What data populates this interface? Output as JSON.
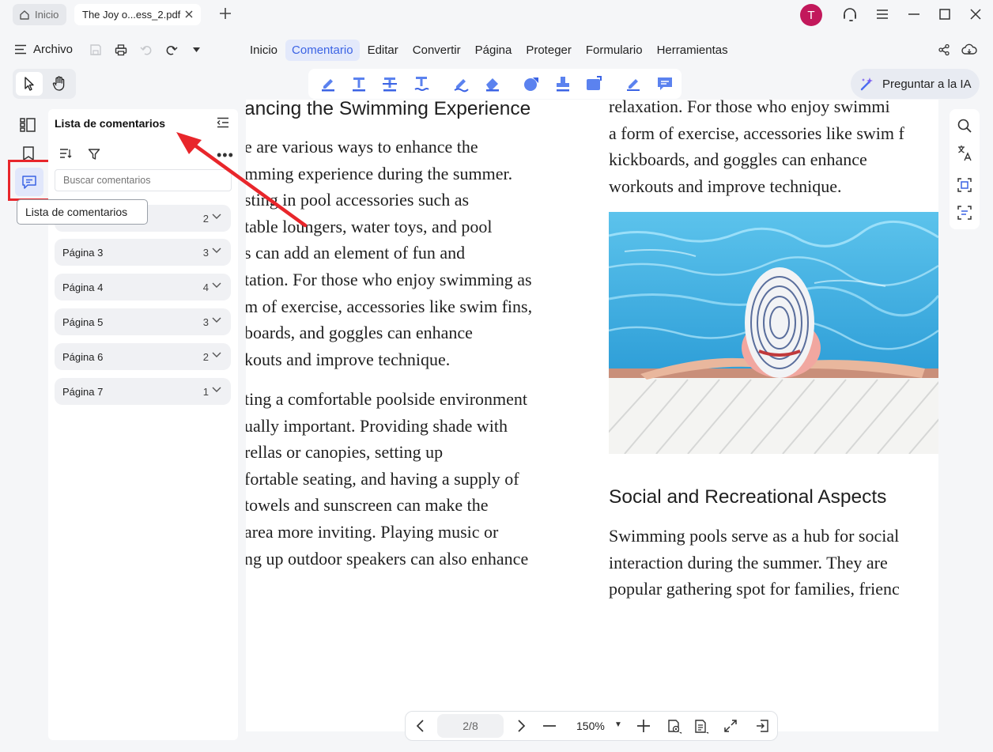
{
  "tabs": {
    "home_label": "Inicio",
    "doc_label": "The Joy o...ess_2.pdf"
  },
  "user": {
    "avatar_initial": "T",
    "avatar_color": "#c2185b"
  },
  "menubar": {
    "file_label": "Archivo",
    "items": [
      "Inicio",
      "Comentario",
      "Editar",
      "Convertir",
      "Página",
      "Proteger",
      "Formulario",
      "Herramientas"
    ],
    "active_index": 1
  },
  "ai": {
    "label": "Preguntar a la IA"
  },
  "tooltip": {
    "text": "Lista de comentarios"
  },
  "comments_panel": {
    "title": "Lista de comentarios",
    "search_placeholder": "Buscar comentarios",
    "first_row_count": "2",
    "pages": [
      {
        "label": "Página 3",
        "count": "3"
      },
      {
        "label": "Página 4",
        "count": "4"
      },
      {
        "label": "Página 5",
        "count": "3"
      },
      {
        "label": "Página 6",
        "count": "2"
      },
      {
        "label": "Página 7",
        "count": "1"
      }
    ]
  },
  "document": {
    "left_heading": "ancing the Swimming Experience",
    "left_para1": [
      "e are various ways to enhance the",
      "mming experience during the summer.",
      "sting in pool accessories such as",
      "table loungers, water toys, and pool",
      "s can add an element of fun and",
      "tation. For those who enjoy swimming as",
      "m of exercise, accessories like swim fins,",
      "boards, and goggles can enhance",
      "kouts and improve technique."
    ],
    "left_para2": [
      "ting a comfortable poolside environment",
      "ually important. Providing shade with",
      "rellas or canopies, setting up",
      "fortable seating, and having a supply of",
      " towels and sunscreen can make the",
      " area more inviting. Playing music or",
      "ng up outdoor speakers can also enhance"
    ],
    "right_top": [
      "relaxation. For those who enjoy swimmi",
      "a form of exercise, accessories like swim f",
      "kickboards, and goggles can enhance",
      "workouts and improve technique."
    ],
    "right_heading": "Social and Recreational Aspects",
    "right_para": [
      "Swimming pools serve as a hub for social",
      "interaction during the summer. They are",
      "popular gathering spot for families, frienc"
    ]
  },
  "bottom_nav": {
    "page_indicator": "2/8",
    "zoom": "150%"
  },
  "colors": {
    "accent": "#3b63e4",
    "highlight_box": "#e8262b"
  },
  "icons": [
    "home-icon",
    "close-icon",
    "plus-icon",
    "headset-icon",
    "hamburger-icon",
    "minimize-icon",
    "maximize-icon",
    "save-icon",
    "print-icon",
    "undo-icon",
    "redo-icon",
    "share-icon",
    "cloud-icon",
    "cursor-icon",
    "hand-icon",
    "highlight-icon",
    "text-icon",
    "strikethrough-icon",
    "underline-icon",
    "pencil-icon",
    "eraser-icon",
    "shape-icon",
    "stamp-icon",
    "attachment-icon",
    "signature-icon",
    "note-icon",
    "ai-icon",
    "thumbnails-icon",
    "bookmark-icon",
    "comment-icon",
    "search-icon",
    "translate-icon",
    "scan-icon",
    "ocr-icon",
    "collapse-icon",
    "sort-icon",
    "filter-icon",
    "chevron-down-icon",
    "prev-icon",
    "next-icon",
    "zoom-out-icon",
    "zoom-in-icon"
  ]
}
